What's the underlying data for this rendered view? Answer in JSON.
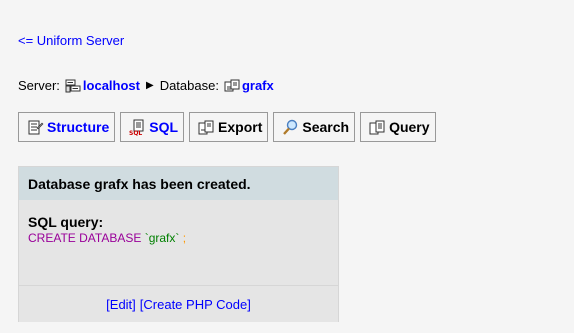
{
  "back_link": "<= Uniform Server",
  "breadcrumb": {
    "server_label": "Server:",
    "server_name": "localhost",
    "database_label": "Database:",
    "database_name": "grafx"
  },
  "tabs": [
    {
      "label": "Structure",
      "icon": "structure-icon",
      "color": "#0000ff"
    },
    {
      "label": "SQL",
      "icon": "sql-icon",
      "color": "#0000ff"
    },
    {
      "label": "Export",
      "icon": "export-icon",
      "color": "#000000"
    },
    {
      "label": "Search",
      "icon": "search-icon",
      "color": "#000000"
    },
    {
      "label": "Query",
      "icon": "query-icon",
      "color": "#000000"
    }
  ],
  "message": {
    "header": "Database grafx has been created.",
    "sql_label": "SQL query:",
    "sql_keyword": "CREATE DATABASE",
    "sql_identifier": "`grafx`",
    "sql_terminator": ";",
    "edit_link": "[Edit]",
    "php_link": "[Create PHP Code]"
  },
  "colors": {
    "link": "#0000ff",
    "header_bg": "#d0dce0",
    "box_bg": "#e5e5e5",
    "sql_keyword": "#990099",
    "sql_identifier": "#008000",
    "sql_punct": "#ff9900"
  }
}
